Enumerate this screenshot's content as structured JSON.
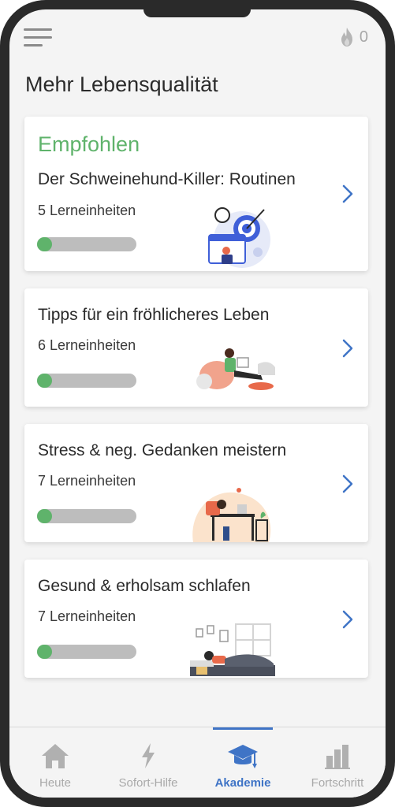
{
  "header": {
    "menu_icon": "menu-icon",
    "streak_icon": "flame-icon",
    "streak_count": "0"
  },
  "page": {
    "title": "Mehr Lebensqualität"
  },
  "courses": [
    {
      "kicker": "Empfohlen",
      "title": "Der Schweinehund-Killer: Routinen",
      "units": "5 Lerneinheiten",
      "progress": 0.15,
      "illustration": "target-calendar-illustration"
    },
    {
      "kicker": "",
      "title": "Tipps für ein fröhlicheres Leben",
      "units": "6 Lerneinheiten",
      "progress": 0.15,
      "illustration": "reading-beanbag-illustration"
    },
    {
      "kicker": "",
      "title": "Stress & neg. Gedanken meistern",
      "units": "7 Lerneinheiten",
      "progress": 0.15,
      "illustration": "stressed-desk-illustration"
    },
    {
      "kicker": "",
      "title": "Gesund & erholsam schlafen",
      "units": "7 Lerneinheiten",
      "progress": 0.15,
      "illustration": "sleeping-bed-illustration"
    }
  ],
  "tabbar": {
    "items": [
      {
        "label": "Heute",
        "icon": "home-icon"
      },
      {
        "label": "Sofort-Hilfe",
        "icon": "bolt-icon"
      },
      {
        "label": "Akademie",
        "icon": "graduation-cap-icon"
      },
      {
        "label": "Fortschritt",
        "icon": "bar-chart-icon"
      }
    ],
    "active": "Akademie"
  },
  "colors": {
    "accent_green": "#5fb36b",
    "active_blue": "#3f74c6",
    "inactive_gray": "#a9a9a9",
    "progress_track": "#bdbdbd"
  }
}
